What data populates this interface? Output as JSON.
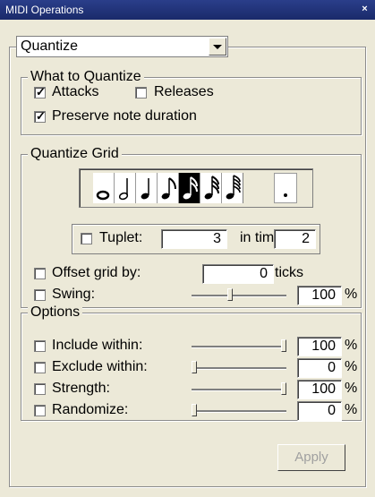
{
  "window": {
    "title": "MIDI Operations",
    "close_glyph": "×"
  },
  "operation": {
    "selected": "Quantize"
  },
  "what_to_quantize": {
    "legend": "What to Quantize",
    "attacks": {
      "label": "Attacks",
      "checked": true
    },
    "releases": {
      "label": "Releases",
      "checked": false
    },
    "preserve": {
      "label": "Preserve note duration",
      "checked": true
    }
  },
  "quantize_grid": {
    "legend": "Quantize Grid",
    "note_values": [
      "whole-note-icon",
      "half-note-icon",
      "quarter-note-icon",
      "eighth-note-icon",
      "sixteenth-note-icon",
      "thirty-second-note-icon",
      "sixty-fourth-note-icon"
    ],
    "selected_note": "sixteenth-note-icon",
    "dotted_icon": "dot-icon",
    "tuplet": {
      "label": "Tuplet:",
      "checked": false,
      "value": "3",
      "in_time_label": "in time",
      "in_time_value": "2"
    },
    "offset": {
      "label": "Offset grid by:",
      "checked": false,
      "value": "0",
      "unit": "ticks"
    },
    "swing": {
      "label": "Swing:",
      "checked": false,
      "value": "100",
      "unit": "%",
      "slider_level": 0.4
    }
  },
  "options": {
    "legend": "Options",
    "rows": [
      {
        "label": "Include within:",
        "checked": false,
        "value": "100",
        "unit": "%",
        "slider_level": 1.0
      },
      {
        "label": "Exclude within:",
        "checked": false,
        "value": "0",
        "unit": "%",
        "slider_level": 0.0
      },
      {
        "label": "Strength:",
        "checked": false,
        "value": "100",
        "unit": "%",
        "slider_level": 1.0
      },
      {
        "label": "Randomize:",
        "checked": false,
        "value": "0",
        "unit": "%",
        "slider_level": 0.0
      }
    ]
  },
  "apply_button": {
    "label": "Apply",
    "enabled": false
  }
}
